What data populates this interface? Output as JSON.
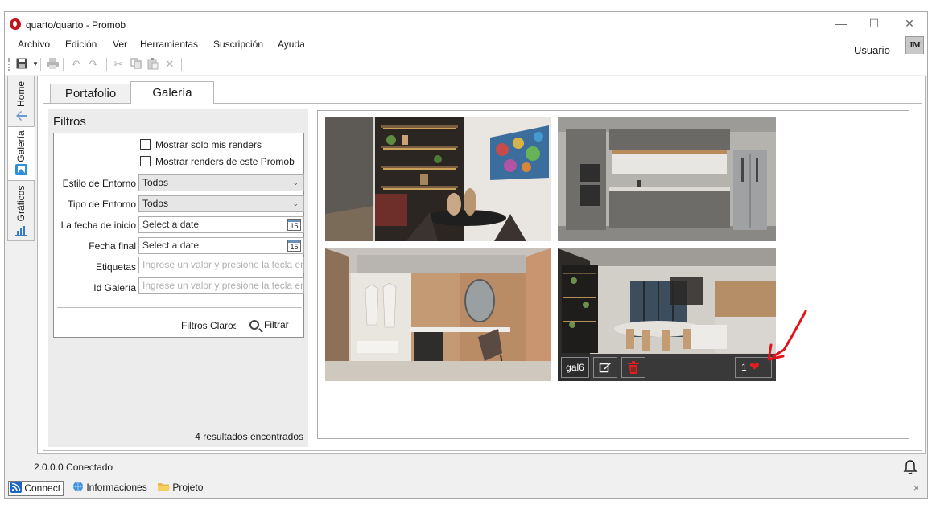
{
  "window": {
    "title": "quarto/quarto - Promob",
    "minimize": "—",
    "maximize": "☐",
    "close": "✕"
  },
  "menu": {
    "items": [
      "Archivo",
      "Edición",
      "Ver",
      "Herramientas",
      "Suscripción",
      "Ayuda"
    ]
  },
  "user": {
    "label": "Usuario",
    "initials": "JM"
  },
  "side_tabs": [
    {
      "label": "Home"
    },
    {
      "label": "Galería",
      "active": true
    },
    {
      "label": "Gráficos"
    }
  ],
  "tabs": [
    {
      "label": "Portafolio",
      "active": false
    },
    {
      "label": "Galería",
      "active": true
    }
  ],
  "filters": {
    "title": "Filtros",
    "checkbox_own": "Mostrar solo mis renders",
    "checkbox_promob": "Mostrar renders de este Promob",
    "env_style_label": "Estilo de Entorno",
    "env_style_value": "Todos",
    "env_type_label": "Tipo de Entorno",
    "env_type_value": "Todos",
    "start_date_label": "La fecha de inicio",
    "start_date_placeholder": "Select a date",
    "end_date_label": "Fecha final",
    "end_date_placeholder": "Select a date",
    "calendar_day": "15",
    "tags_label": "Etiquetas",
    "tags_placeholder": "Ingrese un valor y presione la tecla ent",
    "gallery_id_label": "Id Galería",
    "gallery_id_placeholder": "Ingrese un valor y presione la tecla ent",
    "clear_label": "Filtros Claros",
    "filter_label": "Filtrar",
    "results": "4 resultados encontrados"
  },
  "gallery": {
    "items": [
      {
        "scene": "shelving-room"
      },
      {
        "scene": "kitchen"
      },
      {
        "scene": "dressing-room"
      },
      {
        "scene": "dining-kitchen",
        "name": "gal6",
        "likes": "1"
      }
    ]
  },
  "status": {
    "version": "2.0.0.0",
    "state": "Conectado"
  },
  "bottom": {
    "connect": "Connect",
    "info": "Informaciones",
    "project": "Projeto",
    "close": "×"
  },
  "colors": {
    "accent_red": "#e02020",
    "overlay": "#2d2d2d"
  }
}
